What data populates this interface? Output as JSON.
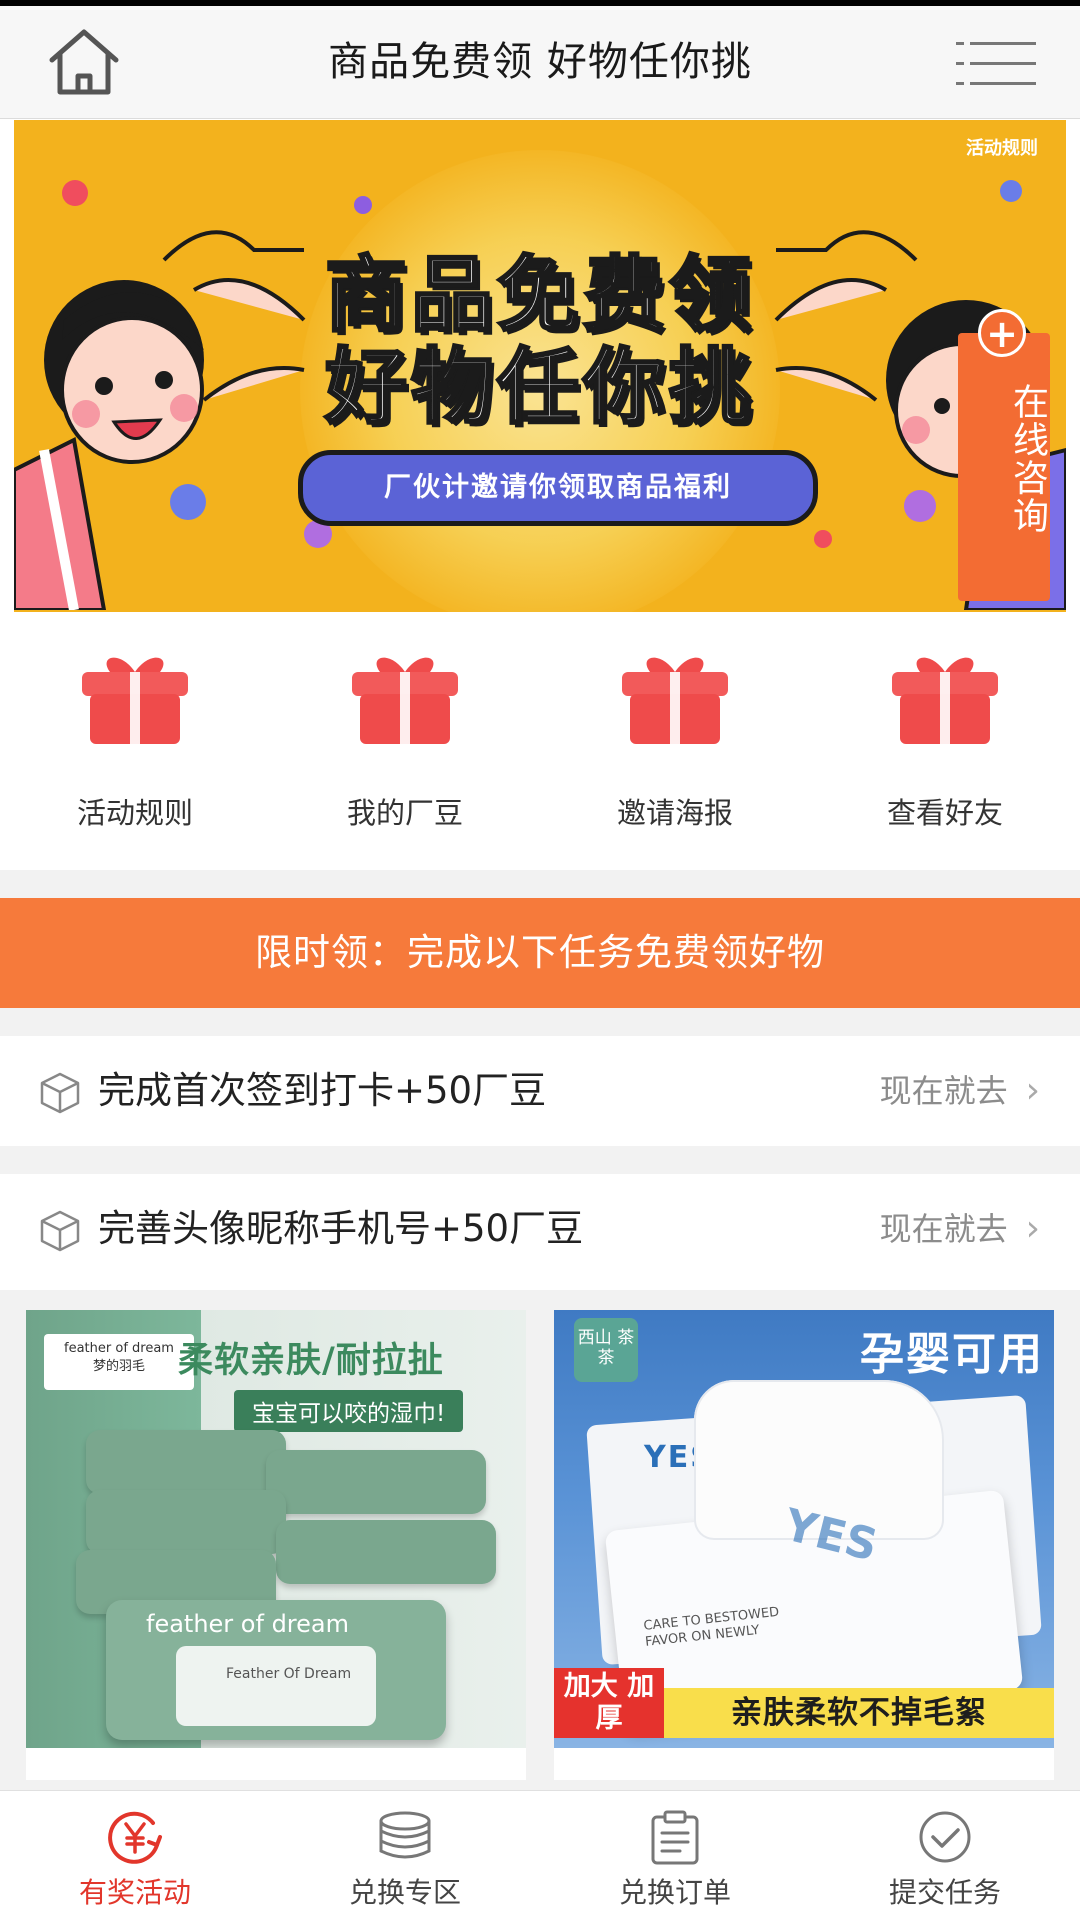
{
  "header": {
    "title": "商品免费领 好物任你挑",
    "home_icon": "home-icon",
    "menu_icon": "menu-icon"
  },
  "banner": {
    "rules_link": "活动规则",
    "headline_line1": "商品免费领",
    "headline_line2": "好物任你挑",
    "pill_text": "厂伙计邀请你领取商品福利",
    "consult": "在线咨询"
  },
  "quick_links": [
    {
      "label": "活动规则",
      "icon": "gift-icon"
    },
    {
      "label": "我的厂豆",
      "icon": "gift-icon"
    },
    {
      "label": "邀请海报",
      "icon": "gift-icon"
    },
    {
      "label": "查看好友",
      "icon": "gift-icon"
    }
  ],
  "promo": {
    "text": "限时领：完成以下任务免费领好物"
  },
  "tasks": [
    {
      "label": "完成首次签到打卡+50厂豆",
      "action": "现在就去"
    },
    {
      "label": "完善头像昵称手机号+50厂豆",
      "action": "现在就去"
    }
  ],
  "products": [
    {
      "brand_en": "feather of dream",
      "brand_cn": "梦的羽毛",
      "headline": "柔软亲肤/耐拉扯",
      "tagline": "宝宝可以咬的湿巾!",
      "pack_text": "feather of dream",
      "lid_text": "Feather Of Dream"
    },
    {
      "logo": "西山 茶茶",
      "headline": "孕婴可用",
      "box_text": "YES",
      "care_text": "CARE TO BESTOWED FAVOR ON NEWLY",
      "badge": "加大 加厚",
      "slogan": "亲肤柔软不掉毛絮"
    }
  ],
  "bottom_nav": [
    {
      "label": "有奖活动",
      "icon": "yen-icon",
      "active": true
    },
    {
      "label": "兑换专区",
      "icon": "coins-icon",
      "active": false
    },
    {
      "label": "兑换订单",
      "icon": "clipboard-icon",
      "active": false
    },
    {
      "label": "提交任务",
      "icon": "check-circle-icon",
      "active": false
    }
  ],
  "colors": {
    "accent_orange": "#f67a3b",
    "active_red": "#e2362b",
    "banner_yellow": "#f3b21d",
    "gift_red": "#ef4b4b"
  }
}
